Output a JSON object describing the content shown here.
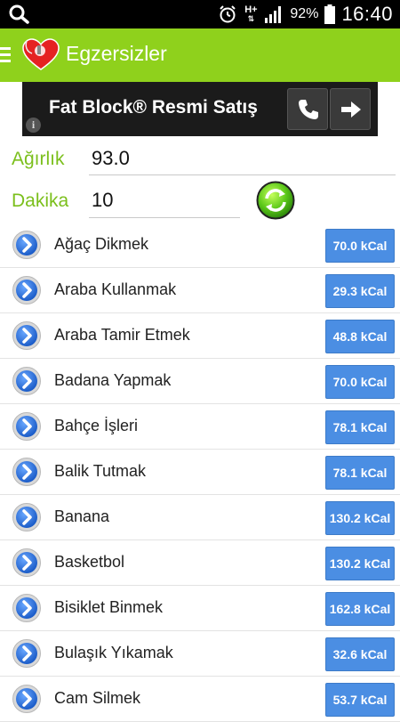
{
  "status_bar": {
    "network": "H+",
    "battery_percent": "92%",
    "time": "16:40"
  },
  "action_bar": {
    "title": "Egzersizler",
    "colors": {
      "background": "#8fd11c"
    }
  },
  "ad_banner": {
    "text": "Fat Block® Resmi Satış",
    "info_label": "i"
  },
  "form": {
    "weight_label": "Ağırlık",
    "weight_value": "93.0",
    "minutes_label": "Dakika",
    "minutes_value": "10"
  },
  "exercises": [
    {
      "name": "Ağaç Dikmek",
      "kcal": "70.0 kCal"
    },
    {
      "name": "Araba Kullanmak",
      "kcal": "29.3 kCal"
    },
    {
      "name": "Araba Tamir Etmek",
      "kcal": "48.8 kCal"
    },
    {
      "name": "Badana Yapmak",
      "kcal": "70.0 kCal"
    },
    {
      "name": "Bahçe İşleri",
      "kcal": "78.1 kCal"
    },
    {
      "name": "Balik Tutmak",
      "kcal": "78.1 kCal"
    },
    {
      "name": "Banana",
      "kcal": "130.2 kCal"
    },
    {
      "name": "Basketbol",
      "kcal": "130.2 kCal"
    },
    {
      "name": "Bisiklet Binmek",
      "kcal": "162.8 kCal"
    },
    {
      "name": "Bulaşık Yıkamak",
      "kcal": "32.6 kCal"
    },
    {
      "name": "Cam Silmek",
      "kcal": "53.7 kCal"
    }
  ]
}
